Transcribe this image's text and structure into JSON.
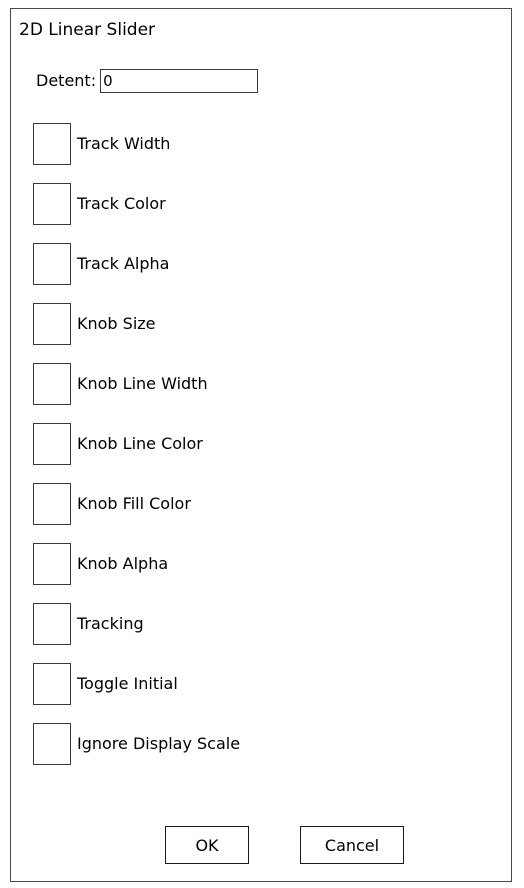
{
  "dialog": {
    "title": "2D Linear Slider",
    "detent": {
      "label": "Detent:",
      "value": "0"
    },
    "options": [
      {
        "label": "Track Width",
        "checked": false
      },
      {
        "label": "Track Color",
        "checked": false
      },
      {
        "label": "Track Alpha",
        "checked": false
      },
      {
        "label": "Knob Size",
        "checked": false
      },
      {
        "label": "Knob Line Width",
        "checked": false
      },
      {
        "label": "Knob Line Color",
        "checked": false
      },
      {
        "label": "Knob Fill Color",
        "checked": false
      },
      {
        "label": "Knob Alpha",
        "checked": false
      },
      {
        "label": "Tracking",
        "checked": false
      },
      {
        "label": "Toggle Initial",
        "checked": false
      },
      {
        "label": "Ignore Display Scale",
        "checked": false
      }
    ],
    "buttons": {
      "ok_label": "OK",
      "cancel_label": "Cancel"
    }
  }
}
